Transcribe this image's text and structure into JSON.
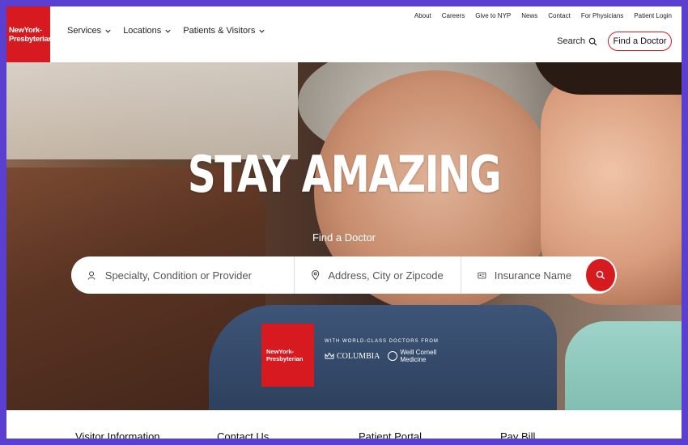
{
  "header": {
    "logo_line1": "NewYork-",
    "logo_line2": "Presbyterian",
    "nav": [
      {
        "label": "Services"
      },
      {
        "label": "Locations"
      },
      {
        "label": "Patients & Visitors"
      }
    ],
    "utility": [
      "About",
      "Careers",
      "Give to NYP",
      "News",
      "Contact",
      "For Physicians",
      "Patient Login"
    ],
    "search_label": "Search",
    "find_doctor_label": "Find a Doctor"
  },
  "hero": {
    "title": "STAY AMAZING",
    "subtitle": "Find a Doctor",
    "search": {
      "specialty_placeholder": "Specialty, Condition or Provider",
      "location_placeholder": "Address, City or Zipcode",
      "insurance_placeholder": "Insurance Name"
    },
    "badge_line1": "NewYork-",
    "badge_line2": "Presbyterian",
    "partners_tag": "WITH WORLD-CLASS DOCTORS FROM",
    "partner1": "COLUMBIA",
    "partner2_line1": "Weill Cornell",
    "partner2_line2": "Medicine"
  },
  "bottom_links": [
    "Visitor Information",
    "Contact Us",
    "Patient Portal",
    "Pay Bill"
  ],
  "colors": {
    "brand_red": "#d71920",
    "frame": "#5a3fd0"
  }
}
